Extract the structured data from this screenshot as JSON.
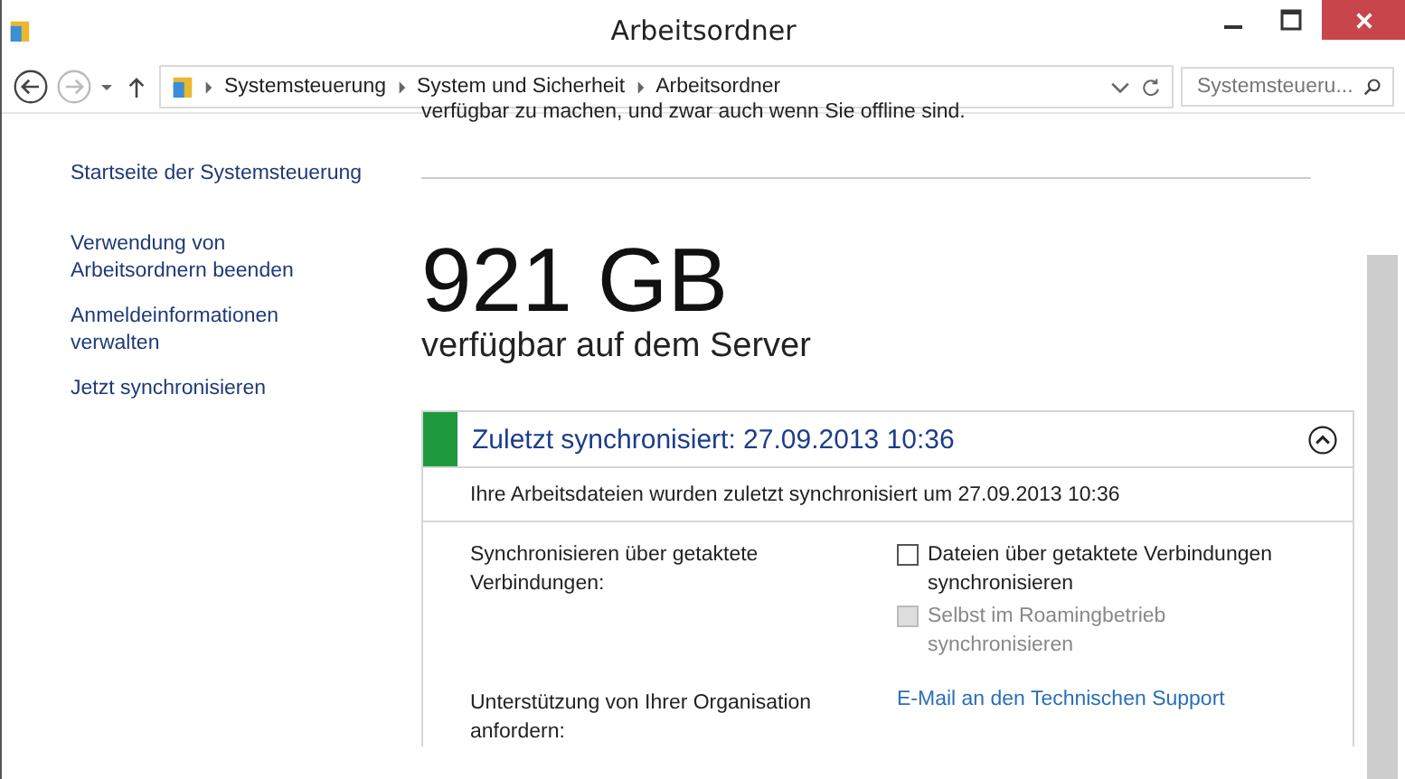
{
  "window": {
    "title": "Arbeitsordner"
  },
  "address_bar": {
    "path": [
      "Systemsteuerung",
      "System und Sicherheit",
      "Arbeitsordner"
    ],
    "search_placeholder": "Systemsteueru..."
  },
  "sidebar": {
    "items": [
      {
        "label": "Startseite der Systemsteuerung"
      },
      {
        "label": "Verwendung von Arbeitsordnern beenden"
      },
      {
        "label": "Anmeldeinformationen verwalten"
      },
      {
        "label": "Jetzt synchronisieren"
      }
    ]
  },
  "intro_text": "verfügbar zu machen, und zwar auch wenn Sie offline sind.",
  "capacity": {
    "value": "921 GB",
    "caption": "verfügbar auf dem Server"
  },
  "sync_panel": {
    "title": "Zuletzt synchronisiert: 27.09.2013 10:36",
    "detail": "Ihre Arbeitsdateien wurden zuletzt synchronisiert um 27.09.2013 10:36",
    "settings": [
      {
        "label": "Synchronisieren über getaktete Verbindungen:",
        "kind": "checkboxes",
        "options": [
          {
            "label": "Dateien über getaktete Verbindungen synchronisieren",
            "checked": false,
            "disabled": false
          },
          {
            "label": "Selbst im Roamingbetrieb synchronisieren",
            "checked": false,
            "disabled": true
          }
        ]
      },
      {
        "label": "Unterstützung von Ihrer Organisation anfordern:",
        "kind": "link",
        "link": "E-Mail an den Technischen Support"
      }
    ]
  }
}
